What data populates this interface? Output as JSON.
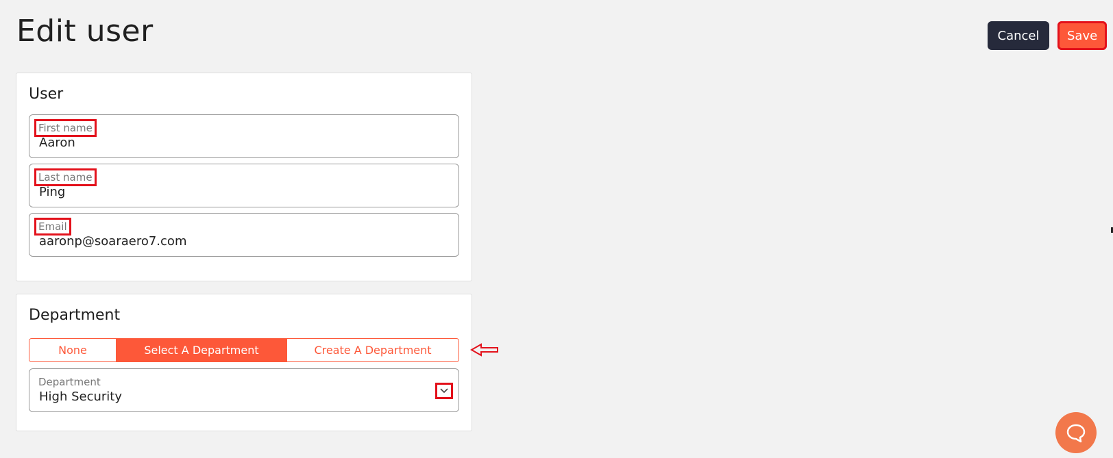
{
  "header": {
    "title": "Edit user",
    "cancel_label": "Cancel",
    "save_label": "Save"
  },
  "user_card": {
    "title": "User",
    "first_name": {
      "label": "First name",
      "value": "Aaron"
    },
    "last_name": {
      "label": "Last name",
      "value": "Ping"
    },
    "email": {
      "label": "Email",
      "value": "aaronp@soaraero7.com"
    }
  },
  "department_card": {
    "title": "Department",
    "options": [
      "None",
      "Select A Department",
      "Create A Department"
    ],
    "selected_option": "Select A Department",
    "department_field": {
      "label": "Department",
      "value": "High Security"
    }
  },
  "icons": {
    "dropdown": "chevron-down-icon",
    "help": "chat-bubble-icon",
    "annotation": "left-arrow-icon"
  },
  "colors": {
    "accent": "#fd5839",
    "dark_button": "#262a3b",
    "highlight": "#e3111b",
    "help_fab": "#f2784b"
  }
}
